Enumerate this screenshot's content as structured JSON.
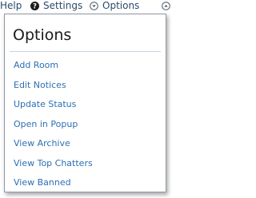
{
  "topbar": {
    "help_label": "Help",
    "settings_label": "Settings",
    "options_label": "Options",
    "help_icon": "question-circle-icon",
    "settings_icon": "chevron-down-circle-icon",
    "options_icon": "chevron-up-circle-icon"
  },
  "dropdown": {
    "title": "Options",
    "items": [
      {
        "label": "Add Room"
      },
      {
        "label": "Edit Notices"
      },
      {
        "label": "Update Status"
      },
      {
        "label": "Open in Popup"
      },
      {
        "label": "View Archive"
      },
      {
        "label": "View Top Chatters"
      },
      {
        "label": "View Banned"
      }
    ]
  },
  "colors": {
    "link": "#2c6fb3",
    "topbar_text": "#2a4a6a",
    "border": "#8f9aa6",
    "separator": "#c7d3de"
  }
}
